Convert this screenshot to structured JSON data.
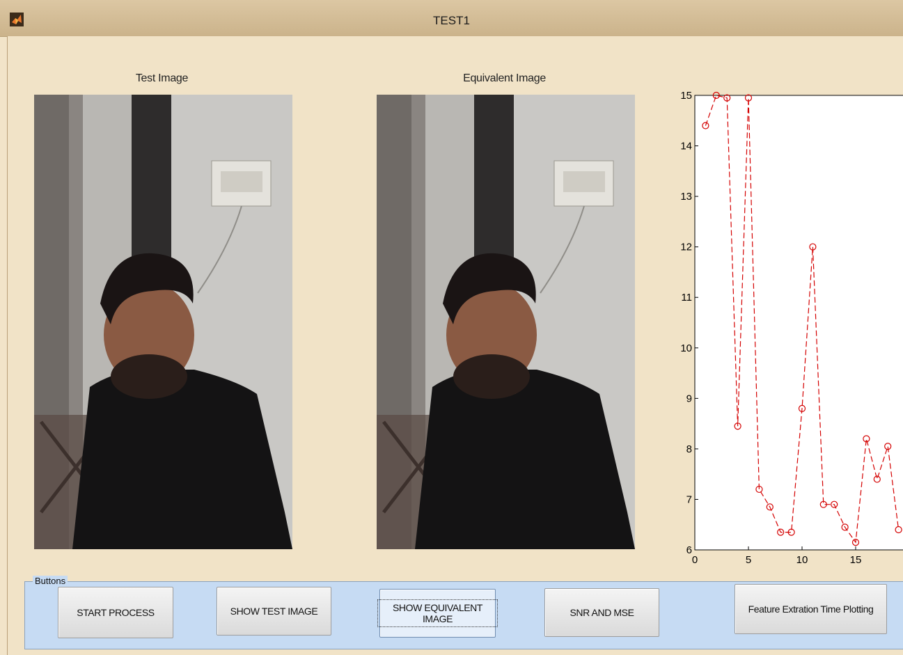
{
  "window": {
    "title": "TEST1"
  },
  "images": {
    "test_title": "Test Image",
    "equivalent_title": "Equivalent Image"
  },
  "chart_data": {
    "type": "line",
    "x": [
      1,
      2,
      3,
      4,
      5,
      6,
      7,
      8,
      9,
      10,
      11,
      12,
      13,
      14,
      15,
      16,
      17,
      18,
      19
    ],
    "series": [
      {
        "values": [
          14.4,
          15.0,
          14.95,
          8.45,
          14.95,
          7.2,
          6.85,
          6.35,
          6.35,
          8.8,
          12.0,
          6.9,
          6.9,
          6.45,
          6.15,
          8.2,
          7.4,
          8.05,
          6.4
        ],
        "color": "#d40000",
        "style": "dashed",
        "marker": "circle"
      }
    ],
    "xlim": [
      0,
      19
    ],
    "ylim": [
      6,
      15
    ],
    "xticks": [
      "0",
      "5",
      "10",
      "15"
    ],
    "yticks": [
      "6",
      "7",
      "8",
      "9",
      "10",
      "11",
      "12",
      "13",
      "14",
      "15"
    ],
    "grid": false
  },
  "buttons_panel": {
    "label": "Buttons",
    "start": "START PROCESS",
    "show_test": "SHOW TEST IMAGE",
    "show_equivalent": "SHOW EQUIVALENT IMAGE",
    "snr_mse": "SNR AND MSE",
    "feature_time": "Feature Extration Time Plotting"
  }
}
